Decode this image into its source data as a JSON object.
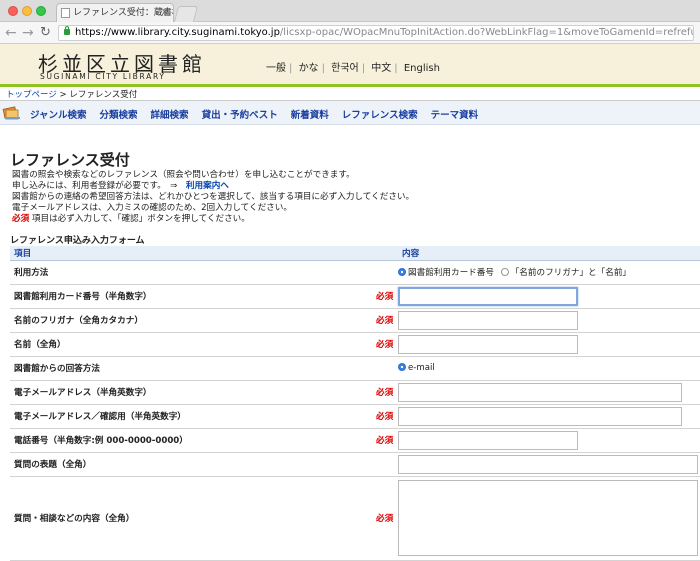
{
  "browser": {
    "tab_title": "レファレンス受付：蔵書検索：...",
    "url_host": "https://www.library.city.suginami.tokyo.jp",
    "url_path": "/licsxp-opac/WOpacMnuTopInitAction.do?WebLinkFlag=1&moveToGamenId=refrefuke"
  },
  "site": {
    "logo_ja": "杉並区立図書館",
    "logo_en": "SUGINAMI CITY LIBRARY",
    "languages": [
      "一般",
      "かな",
      "한국어",
      "中文",
      "English"
    ]
  },
  "breadcrumb": {
    "home": "トップページ",
    "separator": " > ",
    "current": "レファレンス受付"
  },
  "menu": [
    "ジャンル検索",
    "分類検索",
    "詳細検索",
    "貸出・予約ベスト",
    "新着資料",
    "レファレンス検索",
    "テーマ資料"
  ],
  "page": {
    "title": "レファレンス受付",
    "intro_line1": "図書の照会や検索などのレファレンス（照会や問い合わせ）を申し込むことができます。",
    "intro_line2": "申し込みには、利用者登録が必要です。　⇒　",
    "intro_link": "利用案内へ",
    "intro_line3": "図書館からの連絡の希望回答方法は、どれかひとつを選択して、該当する項目に必ず入力してください。",
    "intro_line4": "電子メールアドレスは、入力ミスの確認のため、2回入力してください。",
    "required_word": "必須",
    "intro_line5": " 項目は必ず入力して、「確認」ボタンを押してください。"
  },
  "form": {
    "title": "レファレンス申込み入力フォーム",
    "col_item": "項目",
    "col_content": "内容",
    "required": "必須",
    "usage_label": "利用方法",
    "usage_opt1": "図書館利用カード番号",
    "usage_opt2": "「名前のフリガナ」と「名前」",
    "card_label": "図書館利用カード番号（半角数字）",
    "kana_label": "名前のフリガナ（全角カタカナ）",
    "name_label": "名前（全角）",
    "reply_label": "図書館からの回答方法",
    "reply_opt": "e-mail",
    "email_label": "電子メールアドレス（半角英数字）",
    "email_confirm_label": "電子メールアドレス／確認用（半角英数字）",
    "phone_label": "電話番号（半角数字:例 000-0000-0000）",
    "subject_label": "質問の表題（全角）",
    "question_label": "質問・相談などの内容（全角）"
  }
}
